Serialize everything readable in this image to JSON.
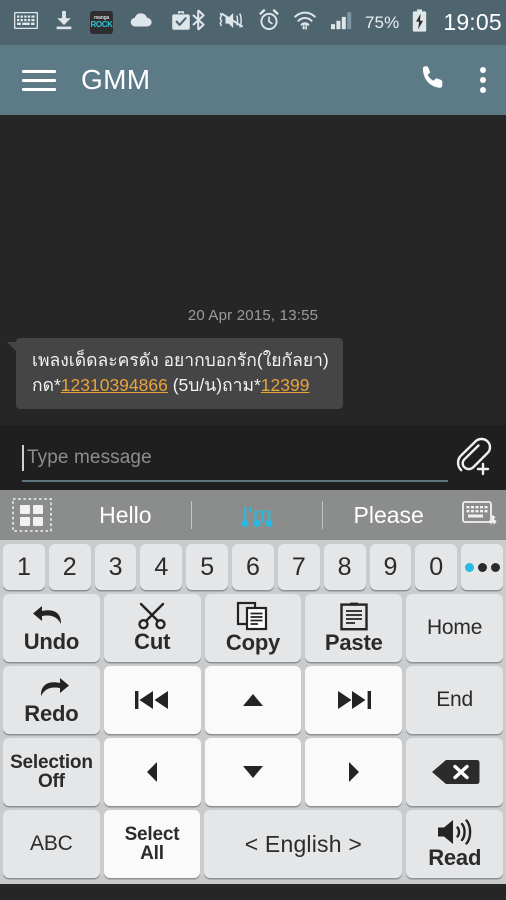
{
  "status_bar": {
    "icons": [
      "keyboard-icon",
      "download-icon",
      "mangarock-icon",
      "cloud-icon",
      "briefcase-check-icon",
      "bluetooth-icon",
      "mute-vibrate-icon",
      "alarm-icon",
      "wifi-icon",
      "signal-icon"
    ],
    "mangarock": {
      "line1": "manga",
      "line2": "ROCK"
    },
    "battery_percent": "75%",
    "battery_state": "charging",
    "time": "19:05"
  },
  "app_bar": {
    "menu_icon": "hamburger-icon",
    "title": "GMM",
    "call_icon": "phone-icon",
    "overflow_icon": "kebab-menu-icon"
  },
  "conversation": {
    "date": "20 Apr 2015, 13:55",
    "message": {
      "line1": "เพลงเด็ดละครดัง  อยากบอกรัก(ใยกัลยา)",
      "line2_pre": "กด*",
      "line2_num1": "12310394866",
      "line2_mid": " (5บ/น)ถาม*",
      "line2_num2": "12399",
      "link_color": "#e8a33d"
    }
  },
  "compose": {
    "placeholder": "Type message",
    "value": "",
    "attach_icon": "paperclip-plus-icon",
    "underline_color": "#5f7681"
  },
  "suggestions": {
    "grid_icon": "app-grid-icon",
    "words": [
      {
        "label": "Hello",
        "active": false
      },
      {
        "label": "I'm",
        "active": true
      },
      {
        "label": "Please",
        "active": false
      }
    ],
    "keyboard_move_icon": "keyboard-move-icon",
    "active_color": "#2ab8e0"
  },
  "keyboard": {
    "rows": [
      {
        "name": "number-row",
        "keys": [
          {
            "label": "1",
            "name": "key-1",
            "style": "num"
          },
          {
            "label": "2",
            "name": "key-2",
            "style": "num"
          },
          {
            "label": "3",
            "name": "key-3",
            "style": "num"
          },
          {
            "label": "4",
            "name": "key-4",
            "style": "num"
          },
          {
            "label": "5",
            "name": "key-5",
            "style": "num"
          },
          {
            "label": "6",
            "name": "key-6",
            "style": "num"
          },
          {
            "label": "7",
            "name": "key-7",
            "style": "num"
          },
          {
            "label": "8",
            "name": "key-8",
            "style": "num"
          },
          {
            "label": "9",
            "name": "key-9",
            "style": "num"
          },
          {
            "label": "0",
            "name": "key-0",
            "style": "num"
          },
          {
            "label": "",
            "name": "key-more",
            "style": "dots"
          }
        ]
      },
      {
        "name": "edit-row",
        "keys": [
          {
            "label": "Undo",
            "name": "key-undo",
            "icon": "undo-arrow-icon"
          },
          {
            "label": "Cut",
            "name": "key-cut",
            "icon": "scissors-icon"
          },
          {
            "label": "Copy",
            "name": "key-copy",
            "icon": "copy-pages-icon"
          },
          {
            "label": "Paste",
            "name": "key-paste",
            "icon": "clipboard-icon"
          },
          {
            "label": "Home",
            "name": "key-home",
            "icon": ""
          }
        ]
      },
      {
        "name": "nav-row-1",
        "keys": [
          {
            "label": "Redo",
            "name": "key-redo",
            "icon": "redo-arrow-icon"
          },
          {
            "label": "",
            "name": "key-prev-word",
            "icon": "skip-backward-icon"
          },
          {
            "label": "",
            "name": "key-arrow-up",
            "icon": "triangle-up-icon"
          },
          {
            "label": "",
            "name": "key-next-word",
            "icon": "skip-forward-icon"
          },
          {
            "label": "End",
            "name": "key-end",
            "icon": ""
          }
        ]
      },
      {
        "name": "nav-row-2",
        "keys": [
          {
            "label": "Selection\nOff",
            "name": "key-selection-off",
            "icon": ""
          },
          {
            "label": "",
            "name": "key-arrow-left",
            "icon": "triangle-left-icon"
          },
          {
            "label": "",
            "name": "key-arrow-down",
            "icon": "triangle-down-icon"
          },
          {
            "label": "",
            "name": "key-arrow-right",
            "icon": "triangle-right-icon"
          },
          {
            "label": "",
            "name": "key-backspace",
            "icon": "backspace-icon"
          }
        ]
      },
      {
        "name": "bottom-row",
        "keys": [
          {
            "label": "ABC",
            "name": "key-abc",
            "icon": ""
          },
          {
            "label": "Select\nAll",
            "name": "key-select-all",
            "icon": ""
          },
          {
            "label": "< English >",
            "name": "key-language",
            "icon": ""
          },
          {
            "label": "Read",
            "name": "key-read",
            "icon": "speaker-icon"
          }
        ]
      }
    ],
    "labels": {
      "one": "1",
      "two": "2",
      "three": "3",
      "four": "4",
      "five": "5",
      "six": "6",
      "seven": "7",
      "eight": "8",
      "nine": "9",
      "zero": "0",
      "undo": "Undo",
      "cut": "Cut",
      "copy": "Copy",
      "paste": "Paste",
      "home": "Home",
      "redo": "Redo",
      "end": "End",
      "selection_off_1": "Selection",
      "selection_off_2": "Off",
      "abc": "ABC",
      "select_1": "Select",
      "select_2": "All",
      "english": "< English >",
      "read": "Read"
    }
  },
  "colors": {
    "statusbar": "#4e6570",
    "appbar": "#5d7a87",
    "chat_bg": "#262626",
    "bubble": "#454545",
    "compose_bg": "#1f1f1f",
    "suggest_bg": "#8b8d8d",
    "keyboard_bg": "#c9cbcd",
    "key_bg": "#e4e6e8",
    "accent": "#2ab8e0"
  }
}
